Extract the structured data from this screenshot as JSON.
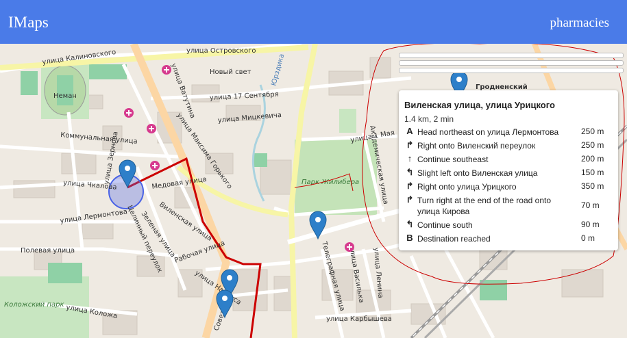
{
  "app": {
    "title": "IMaps",
    "nav_link": "pharmacies"
  },
  "map": {
    "street_labels": {
      "kalinovskogo": "улица Калиновского",
      "ostrovskogo": "улица Островского",
      "novy_svet": "Новый свет",
      "neman": "Неман",
      "vatutina": "улица Ватутина",
      "sentyabrya": "улица 17 Сентября",
      "mitskevicha": "улица Мицкевича",
      "gorkogo": "улица Максима Горького",
      "kommunalnaya": "Коммунальная улица",
      "zernova": "улица Зернова",
      "chkalova": "улица Чкалова",
      "lermontova": "улица Лермонтова",
      "medovaya": "Медовая улица",
      "vilenskaya": "Виленская улица",
      "zelenaya": "Зеленая улица",
      "tselinny": "Целинный переулок",
      "poleva": "Полевая улица",
      "rabochaya": "Рабочая улица",
      "naidusa": "улица Найдуса",
      "sovetskaya": "Советская",
      "kolozha": "улица Коложа",
      "kolozhsky_park": "Коложский парк",
      "yurizdika": "Юрздика",
      "park_zhilibera": "Парк Жилибера",
      "telegrafnaya": "Телеграфная улица",
      "vasilka": "улица Василька",
      "lenina": "улица Ленина",
      "karbysheva": "улица Карбышева",
      "grodnensky": "Гродненский",
      "maya": "улица 1 Мая",
      "akademicheskaya": "Академическая улица"
    },
    "route_color": "#cc0000",
    "marker_color": "#2d7fc9",
    "pharmacy_color": "#d63a8e"
  },
  "routing": {
    "title": "Виленская улица, улица Урицкого",
    "summary": "1.4 km, 2 min",
    "steps": [
      {
        "icon": "A",
        "icon_name": "start-icon",
        "text": "Head northeast on улица Лермонтова",
        "distance": "250 m"
      },
      {
        "icon": "↱",
        "icon_name": "turn-right-icon",
        "text": "Right onto Виленский переулок",
        "distance": "250 m"
      },
      {
        "icon": "↑",
        "icon_name": "straight-icon",
        "text": "Continue southeast",
        "distance": "200 m"
      },
      {
        "icon": "↰",
        "icon_name": "slight-left-icon",
        "text": "Slight left onto Виленская улица",
        "distance": "150 m"
      },
      {
        "icon": "↱",
        "icon_name": "turn-right-icon",
        "text": "Right onto улица Урицкого",
        "distance": "350 m"
      },
      {
        "icon": "↱",
        "icon_name": "turn-right-icon",
        "text": "Turn right at the end of the road onto улица Кирова",
        "distance": "70 m"
      },
      {
        "icon": "↰",
        "icon_name": "slight-left-icon",
        "text": "Continue south",
        "distance": "90 m"
      },
      {
        "icon": "B",
        "icon_name": "destination-icon",
        "text": "Destination reached",
        "distance": "0 m"
      }
    ]
  }
}
